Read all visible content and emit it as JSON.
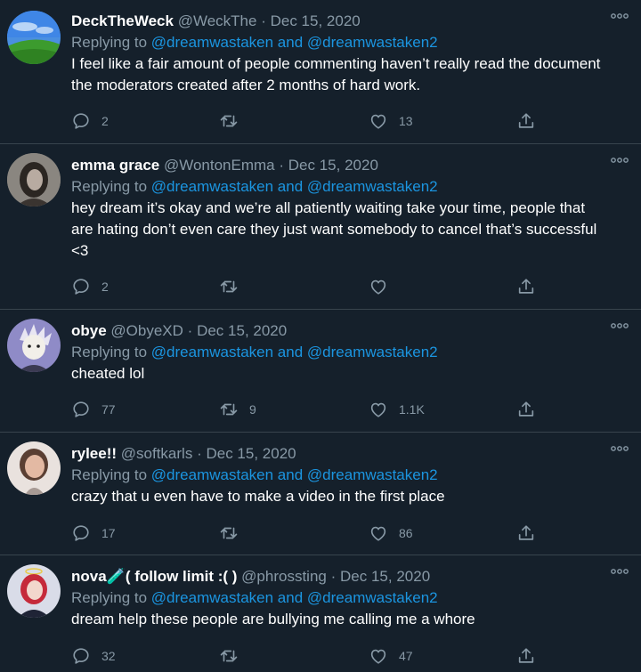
{
  "tweets": [
    {
      "name": "DeckTheWeck",
      "handle": "@WeckThe",
      "dot": "·",
      "date": "Dec 15, 2020",
      "replying_prefix": "Replying to",
      "replying_to_1": "@dreamwastaken",
      "replying_and": "and",
      "replying_to_2": "@dreamwastaken2",
      "text": "I feel like a fair amount of people commenting haven’t really read the document the moderators created after 2 months of hard work.",
      "replies": "2",
      "retweets": "",
      "likes": "13"
    },
    {
      "name": "emma grace",
      "handle": "@WontonEmma",
      "dot": "·",
      "date": "Dec 15, 2020",
      "replying_prefix": "Replying to",
      "replying_to_1": "@dreamwastaken",
      "replying_and": "and",
      "replying_to_2": "@dreamwastaken2",
      "text": "hey dream it’s okay and we’re all patiently waiting take your time, people that are hating don’t even care they just want somebody to cancel that’s successful <3",
      "replies": "2",
      "retweets": "",
      "likes": ""
    },
    {
      "name": "obye",
      "handle": "@ObyeXD",
      "dot": "·",
      "date": "Dec 15, 2020",
      "replying_prefix": "Replying to",
      "replying_to_1": "@dreamwastaken",
      "replying_and": "and",
      "replying_to_2": "@dreamwastaken2",
      "text": "cheated lol",
      "replies": "77",
      "retweets": "9",
      "likes": "1.1K"
    },
    {
      "name": "rylee!!",
      "handle": "@softkarls",
      "dot": "·",
      "date": "Dec 15, 2020",
      "replying_prefix": "Replying to",
      "replying_to_1": "@dreamwastaken",
      "replying_and": "and",
      "replying_to_2": "@dreamwastaken2",
      "text": "crazy that u even have to make a video in the first place",
      "replies": "17",
      "retweets": "",
      "likes": "86"
    },
    {
      "name": "nova🧪( follow limit :( )",
      "handle": "@phrossting",
      "dot": "·",
      "date": "Dec 15, 2020",
      "replying_prefix": "Replying to",
      "replying_to_1": "@dreamwastaken",
      "replying_and": "and",
      "replying_to_2": "@dreamwastaken2",
      "text": "dream help these people are bullying me calling me a whore",
      "replies": "32",
      "retweets": "",
      "likes": "47"
    }
  ],
  "icons": {
    "more": "more-icon",
    "reply": "reply-icon",
    "retweet": "retweet-icon",
    "like": "heart-icon",
    "share": "share-icon"
  },
  "colors": {
    "background": "#15202b",
    "secondary_text": "#8899a6",
    "link": "#1b95e0",
    "divider": "#38444d"
  }
}
